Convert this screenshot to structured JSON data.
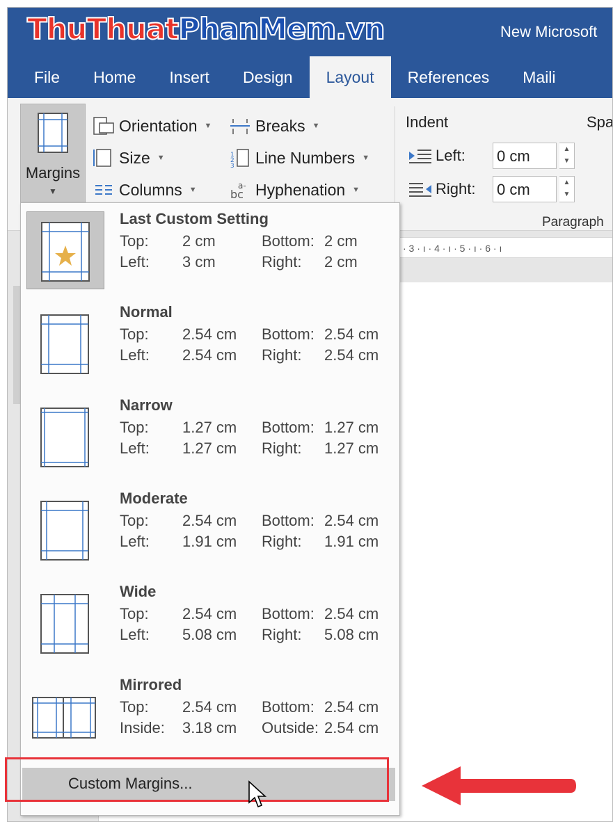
{
  "window": {
    "watermark_part1": "ThuThuat",
    "watermark_part2": "PhanMem",
    "watermark_part3": ".vn",
    "doc_title": "New Microsoft"
  },
  "tabs": [
    {
      "label": "File"
    },
    {
      "label": "Home"
    },
    {
      "label": "Insert"
    },
    {
      "label": "Design"
    },
    {
      "label": "Layout",
      "active": true
    },
    {
      "label": "References"
    },
    {
      "label": "Maili"
    }
  ],
  "ribbon": {
    "margins_label": "Margins",
    "orientation": "Orientation",
    "size": "Size",
    "columns": "Columns",
    "breaks": "Breaks",
    "line_numbers": "Line Numbers",
    "hyphenation": "Hyphenation",
    "indent_title": "Indent",
    "spacing_title": "Spa",
    "indent_left_label": "Left:",
    "indent_left_value": "0 cm",
    "indent_right_label": "Right:",
    "indent_right_value": "0 cm",
    "group_label": "Paragraph"
  },
  "ruler_text": "· 3 · ı · 4 · ı · 5 · ı · 6 · ı",
  "margin_options": [
    {
      "name": "Last Custom Setting",
      "icon": "page-star-icon",
      "selected": true,
      "row1": [
        "Top:",
        "2 cm",
        "Bottom:",
        "2 cm"
      ],
      "row2": [
        "Left:",
        "3 cm",
        "Right:",
        "2 cm"
      ]
    },
    {
      "name": "Normal",
      "icon": "page-normal-icon",
      "row1": [
        "Top:",
        "2.54 cm",
        "Bottom:",
        "2.54 cm"
      ],
      "row2": [
        "Left:",
        "2.54 cm",
        "Right:",
        "2.54 cm"
      ]
    },
    {
      "name": "Narrow",
      "icon": "page-narrow-icon",
      "row1": [
        "Top:",
        "1.27 cm",
        "Bottom:",
        "1.27 cm"
      ],
      "row2": [
        "Left:",
        "1.27 cm",
        "Right:",
        "1.27 cm"
      ]
    },
    {
      "name": "Moderate",
      "icon": "page-moderate-icon",
      "row1": [
        "Top:",
        "2.54 cm",
        "Bottom:",
        "2.54 cm"
      ],
      "row2": [
        "Left:",
        "1.91 cm",
        "Right:",
        "1.91 cm"
      ]
    },
    {
      "name": "Wide",
      "icon": "page-wide-icon",
      "row1": [
        "Top:",
        "2.54 cm",
        "Bottom:",
        "2.54 cm"
      ],
      "row2": [
        "Left:",
        "5.08 cm",
        "Right:",
        "5.08 cm"
      ]
    },
    {
      "name": "Mirrored",
      "icon": "page-mirrored-icon",
      "row1": [
        "Top:",
        "2.54 cm",
        "Bottom:",
        "2.54 cm"
      ],
      "row2": [
        "Inside:",
        "3.18 cm",
        "Outside:",
        "2.54 cm"
      ]
    }
  ],
  "custom_margins_label": "Custom Margins...",
  "colors": {
    "title_blue": "#2b579a",
    "highlight_red": "#e8333a",
    "margin_line_blue": "#3c78c8",
    "star_gold": "#e6b04a"
  }
}
